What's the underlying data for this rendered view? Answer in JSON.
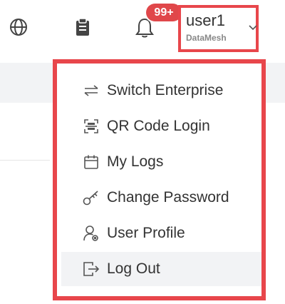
{
  "header": {
    "notifications_badge": "99+",
    "user": {
      "name": "user1",
      "organization": "DataMesh"
    },
    "icons": [
      "globe-icon",
      "clipboard-icon",
      "bell-icon",
      "chevron-down-icon"
    ]
  },
  "menu": {
    "items": [
      {
        "label": "Switch Enterprise",
        "icon": "switch-icon"
      },
      {
        "label": "QR Code Login",
        "icon": "qr-scan-icon"
      },
      {
        "label": "My Logs",
        "icon": "calendar-icon"
      },
      {
        "label": "Change Password",
        "icon": "key-icon"
      },
      {
        "label": "User Profile",
        "icon": "user-settings-icon"
      },
      {
        "label": "Log Out",
        "icon": "logout-icon",
        "highlighted": true
      }
    ]
  },
  "colors": {
    "highlight_border": "#e8464b",
    "badge": "#e0474a",
    "text": "#333333",
    "muted_text": "#888888",
    "hover_bg": "#f2f3f5"
  }
}
